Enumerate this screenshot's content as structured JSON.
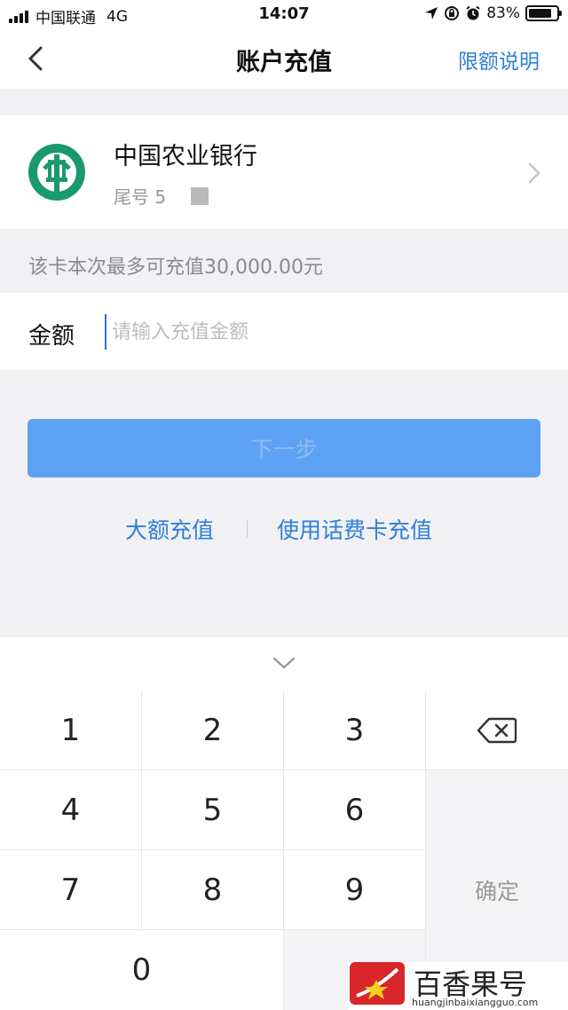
{
  "status_bar": {
    "carrier": "中国联通",
    "network": "4G",
    "time": "14:07",
    "battery": "83%",
    "battery_level": 0.83
  },
  "nav": {
    "title": "账户充值",
    "limit_link": "限额说明"
  },
  "bank": {
    "name": "中国农业银行",
    "tail_label": "尾号 5",
    "logo_color": "#1a9a6c"
  },
  "limit_info": "该卡本次最多可充值30,000.00元",
  "amount": {
    "label": "金额",
    "placeholder": "请输入充值金额",
    "value": ""
  },
  "next_button": "下一步",
  "links": {
    "large": "大额充值",
    "phone_card": "使用话费卡充值"
  },
  "keyboard": {
    "keys": [
      "1",
      "2",
      "3",
      "4",
      "5",
      "6",
      "7",
      "8",
      "9",
      "0"
    ],
    "confirm": "确定"
  },
  "watermark": {
    "text": "百香果号",
    "url": "huangjinbaixiangguo.com"
  },
  "colors": {
    "accent": "#2f7fd9",
    "button": "#5ea3f3"
  }
}
